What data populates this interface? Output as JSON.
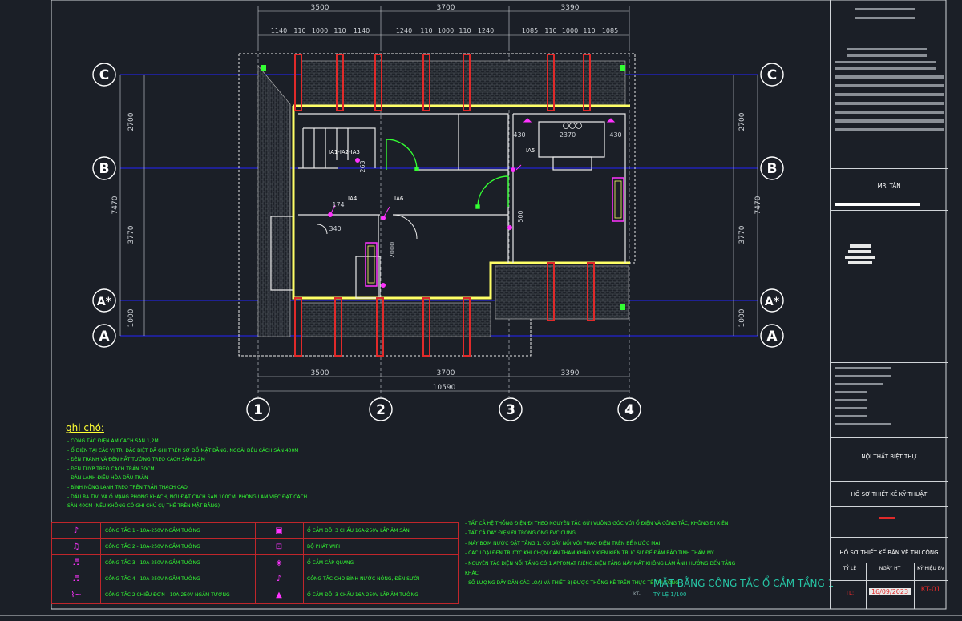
{
  "plan": {
    "top_dims_major": [
      "3500",
      "3700",
      "3390"
    ],
    "top_dims_minor": [
      "1140",
      "110",
      "1000",
      "110",
      "1140",
      "1240",
      "110",
      "1000",
      "110",
      "1240",
      "1085",
      "110",
      "1000",
      "110",
      "1085"
    ],
    "bottom_dims_major": [
      "3500",
      "3700",
      "3390"
    ],
    "bottom_total": "10590",
    "left_dims": [
      "2700",
      "7470",
      "3770",
      "1000"
    ],
    "right_dims": [
      "2700",
      "7470",
      "3770",
      "1000"
    ],
    "grid_rows": [
      "C",
      "B",
      "A*",
      "A"
    ],
    "grid_cols": [
      "1",
      "2",
      "3",
      "4"
    ],
    "inner_dims": [
      "430",
      "2370",
      "430",
      "263",
      "174",
      "340",
      "2000",
      "500"
    ],
    "tags": [
      "IA1-IA2-IA3",
      "IA5",
      "IA4",
      "IA6"
    ]
  },
  "notes": {
    "title": "ghi chó:",
    "items": [
      "- CÔNG TẮC ĐIỆN ÂM CÁCH SÀN 1,2M",
      "- Ổ ĐIỆN TẠI CÁC VỊ TRÍ ĐẶC BIỆT ĐÃ GHI TRÊN SƠ ĐỒ MẶT BẰNG. NGOÀI ĐỀU CÁCH SÀN 400M",
      "- ĐÈN TRANH VÀ ĐÈN HẮT TƯỜNG TREO CÁCH SÀN 2,2M",
      "- ĐÈN TUÝP TREO CÁCH TRẦN 30CM",
      "- ĐÁN LẠNH ĐIỀU HÒA DẤU TRẦN",
      "- BÌNH NÓNG LẠNH TREO TRÊN TRẦN THẠCH CAO",
      "- DẦU RA TIVI VÀ Ổ MẠNG PHÒNG KHÁCH, NƠI ĐẶT CÁCH SÀN 100CM, PHÒNG LÀM VIỆC ĐẶT CÁCH",
      "SÀN 40CM (NẾU KHÔNG CÓ GHI CHỦ CỤ THỂ TRÊN MẶT BẰNG)"
    ],
    "items2": [
      "- TẤT CẢ HỆ THỐNG ĐIỆN ĐI THEO NGUYÊN TẮC GỬI VUÔNG GÓC VỚI Ổ ĐIỆN VÀ CÔNG TẮC, KHÔNG ĐI XIÊN",
      "- TẤT CẢ DÂY ĐIỆN ĐI TRONG ỐNG PVC CỨNG",
      "- MÁY BƠM NƯỚC ĐẶT TẦNG 1, CÓ DÂY NỐI VỚI PHAO ĐIỆN TRÊN BỂ NƯỚC MÁI",
      "- CÁC LOẠI ĐÈN TRƯỚC KHI CHỌN CẦN THAM KHẢO Ý KIẾN KIẾN TRÚC SƯ ĐỂ ĐẢM BẢO TÍNH THẨM MỸ",
      "- NGUYÊN TẮC ĐIỆN NỐI TẦNG CÓ 1 APTOMAT RIÊNG.ĐIỆN TẦNG NÀY MẤT KHÔNG LÀM ẢNH HƯỞNG ĐẾN TẦNG KHÁC",
      "- SỐ LƯỢNG DÂY DẪN CÁC LOẠI VÀ THIẾT BỊ ĐƯỢC THỐNG KÊ TRÊN THỰC TẾ THI CÔNG"
    ]
  },
  "legend": {
    "left": [
      "CÔNG TẮC 1 - 10A-250V NGẦM TƯỜNG",
      "CÔNG TẮC 2 - 10A-250V NGẦM TƯỜNG",
      "CÔNG TẮC 3 - 10A-250V NGẦM TƯỜNG",
      "CÔNG TẮC 4 - 10A-250V NGẦM TƯỜNG",
      "CÔNG TẮC 2 CHIỀU ĐƠN - 10A-250V NGẦM TƯỜNG"
    ],
    "right": [
      "Ổ CẮM ĐÔI 3 CHẤU 16A-250V LẮP ÂM SÀN",
      "BỘ PHÁT WIFI",
      "Ổ CẮM CÁP QUANG",
      "CÔNG TẮC CHO BÌNH NƯỚC NÓNG, ĐÈN SƯỞI",
      "Ổ CẮM ĐÔI 3 CHẤU 16A-250V LẮP ÂM TƯỜNG"
    ]
  },
  "titleblock": {
    "owner": "MR. TÂN",
    "project": "NỘI THẤT BIỆT THỰ",
    "stage": "HỒ SƠ THIẾT KẾ KỸ THUẬT",
    "set": "HỒ SƠ THIẾT KẾ BẢN VẼ THI CÔNG",
    "hdr_scale": "TỶ LỆ",
    "hdr_date": "NGÀY HT",
    "hdr_code": "KÝ HIỆU BV",
    "scale": "TL:",
    "date": "16/09/2023",
    "code": "KT-01"
  },
  "sheet": {
    "title": "MẶT BẰNG CÔNG TẮC Ổ CẮM TẦNG 1",
    "scale": "TỶ LỆ 1/100",
    "code_left": "KT-"
  },
  "colors": {
    "background": "#1b1f27",
    "grid_line": "#2323ff",
    "wall": "#ffff66",
    "column": "#e02a2a",
    "device": "#ff33ff",
    "door": "#33ff33",
    "note": "#33ff33"
  }
}
